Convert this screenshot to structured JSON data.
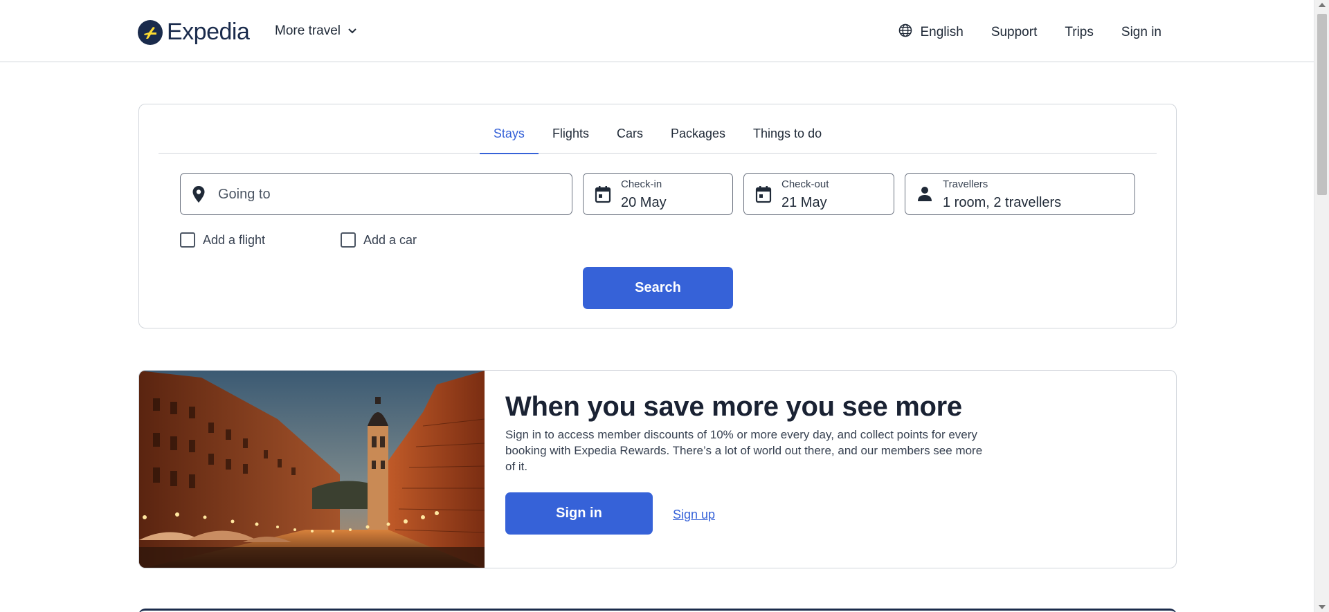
{
  "header": {
    "brand": "Expedia",
    "more_travel": "More travel",
    "language": "English",
    "support": "Support",
    "trips": "Trips",
    "sign_in": "Sign in"
  },
  "search": {
    "tabs": [
      {
        "label": "Stays",
        "active": true
      },
      {
        "label": "Flights",
        "active": false
      },
      {
        "label": "Cars",
        "active": false
      },
      {
        "label": "Packages",
        "active": false
      },
      {
        "label": "Things to do",
        "active": false
      }
    ],
    "going_to": {
      "placeholder": "Going to",
      "icon": "location-pin-icon"
    },
    "check_in": {
      "label": "Check-in",
      "value": "20 May",
      "icon": "calendar-icon"
    },
    "check_out": {
      "label": "Check-out",
      "value": "21 May",
      "icon": "calendar-icon"
    },
    "travellers": {
      "label": "Travellers",
      "value": "1 room, 2 travellers",
      "icon": "person-icon"
    },
    "add_flight": {
      "label": "Add a flight",
      "checked": false
    },
    "add_car": {
      "label": "Add a car",
      "checked": false
    },
    "search_button": "Search"
  },
  "promo": {
    "title": "When you save more you see more",
    "description": "Sign in to access member discounts of 10% or more every day, and collect points for every booking with Expedia Rewards. There’s a lot of world out there, and our members see more of it.",
    "sign_in_button": "Sign in",
    "sign_up_link": "Sign up"
  },
  "colors": {
    "accent": "#3662d8",
    "brand_navy": "#1a2b4c",
    "border": "#d1d5db"
  }
}
